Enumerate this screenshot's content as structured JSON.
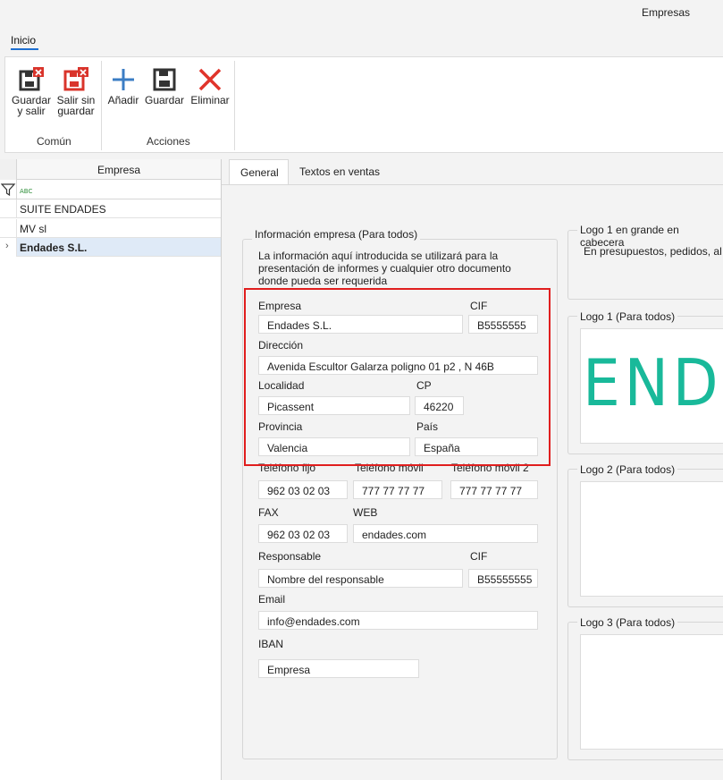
{
  "window": {
    "title": "Empresas"
  },
  "ribbon": {
    "tab": "Inicio",
    "groups": [
      {
        "label": "Común"
      },
      {
        "label": "Acciones"
      }
    ],
    "buttons": {
      "save_exit": "Guardar y salir",
      "exit_no_save": "Salir sin guardar",
      "add": "Añadir",
      "save": "Guardar",
      "delete": "Eliminar"
    }
  },
  "grid": {
    "column": "Empresa",
    "rows": [
      "SUITE ENDADES",
      "MV sl",
      "Endades S.L."
    ],
    "selected_index": 2
  },
  "tabs": [
    "General",
    "Textos en ventas"
  ],
  "info": {
    "title": "Información empresa (Para todos)",
    "description_lines": [
      "La información aquí introducida se utilizará para la",
      "presentación de informes y cualquier otro documento",
      "donde pueda ser requerida"
    ],
    "empresa_label": "Empresa",
    "empresa_value": "Endades S.L.",
    "cif_label": "CIF",
    "cif_value": "B5555555",
    "direccion_label": "Dirección",
    "direccion_value": "Avenida Escultor Galarza poligno 01 p2 , N 46B",
    "localidad_label": "Localidad",
    "localidad_value": "Picassent",
    "cp_label": "CP",
    "cp_value": "46220",
    "provincia_label": "Provincia",
    "provincia_value": "Valencia",
    "pais_label": "País",
    "pais_value": "España",
    "tel_fijo_label": "Teléfono fijo",
    "tel_fijo_value": "962 03 02 03",
    "tel_movil_label": "Teléfono móvil",
    "tel_movil_value": "777 77 77 77",
    "tel_movil2_label": "Teléfono móvil 2",
    "tel_movil2_value": "777 77 77 77",
    "fax_label": "FAX",
    "fax_value": "962 03 02 03",
    "web_label": "WEB",
    "web_value": "endades.com",
    "responsable_label": "Responsable",
    "responsable_value": "Nombre del responsable",
    "cif2_label": "CIF",
    "cif2_value": "B55555555",
    "email_label": "Email",
    "email_value": "info@endades.com",
    "iban_label": "IBAN",
    "iban_value": "Empresa"
  },
  "logos": {
    "cabecera_title": "Logo 1 en grande en cabecera",
    "cabecera_text": "En presupuestos, pedidos, al",
    "logo1_title": "Logo 1 (Para todos)",
    "logo1_text": "END",
    "logo1_color": "#19b99a",
    "logo2_title": "Logo 2 (Para todos)",
    "logo3_title": "Logo 3 (Para todos)"
  },
  "colors": {
    "accent": "#1e6fd1",
    "highlight": "#e01e1e",
    "selected_row": "#dfeaf7"
  }
}
